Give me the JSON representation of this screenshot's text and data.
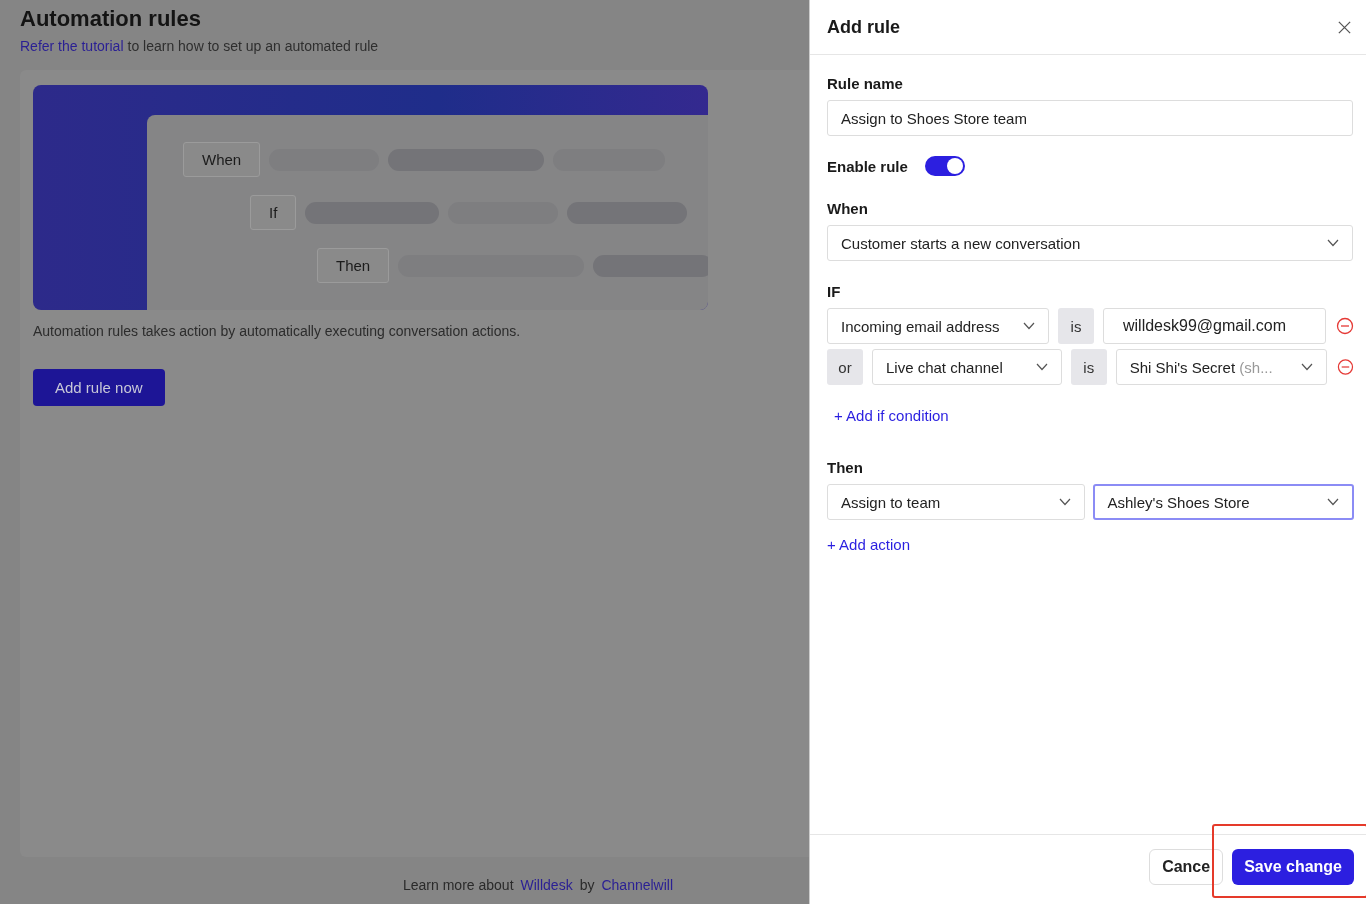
{
  "page": {
    "title": "Automation rules",
    "subtitle_link": "Refer the tutorial",
    "subtitle_text": "to learn how to set up an automated rule",
    "banner": {
      "steps": [
        "When",
        "If",
        "Then"
      ]
    },
    "description": "Automation rules takes action by automatically executing conversation actions.",
    "add_button": "Add rule now",
    "footer": {
      "prefix": "Learn more about",
      "link_1": "Willdesk",
      "middle": "by",
      "link_2": "Channelwill"
    }
  },
  "drawer": {
    "title": "Add rule",
    "rule_name": {
      "label": "Rule name",
      "value": "Assign to Shoes Store team"
    },
    "enable": {
      "label": "Enable rule",
      "on": true
    },
    "when": {
      "label": "When",
      "value": "Customer starts a new conversation"
    },
    "if": {
      "label": "IF",
      "conditions": [
        {
          "field": "Incoming email address",
          "operator": "is",
          "kind": "input",
          "value": "willdesk99@gmail.com"
        },
        {
          "connector": "or",
          "field": "Live chat channel",
          "operator": "is",
          "kind": "select",
          "value": "Shi Shi's Secret",
          "value_hint": "(sh..."
        }
      ],
      "add": "+ Add if condition"
    },
    "then": {
      "label": "Then",
      "actions": [
        {
          "value": "Assign to team",
          "focused": false
        },
        {
          "value": "Ashley's Shoes Store",
          "focused": true
        }
      ],
      "add": "+ Add action"
    },
    "buttons": [
      {
        "label": "Cance",
        "kind": "secondary"
      },
      {
        "label": "Save change",
        "kind": "primary"
      }
    ],
    "highlight": true
  }
}
